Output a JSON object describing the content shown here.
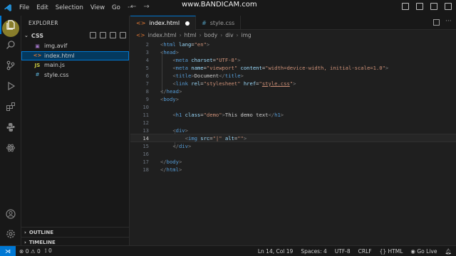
{
  "menu": [
    "File",
    "Edit",
    "Selection",
    "View",
    "Go",
    "···"
  ],
  "watermark": "www.BANDICAM.com",
  "explorer": {
    "title": "EXPLORER",
    "folder": "CSS",
    "files": [
      {
        "name": "img.avif",
        "icon": "image-icon"
      },
      {
        "name": "index.html",
        "icon": "html-icon"
      },
      {
        "name": "main.js",
        "icon": "js-icon"
      },
      {
        "name": "style.css",
        "icon": "css-icon"
      }
    ],
    "outline": "OUTLINE",
    "timeline": "TIMELINE"
  },
  "tabs": [
    {
      "label": "index.html",
      "modified": true
    },
    {
      "label": "style.css",
      "modified": false
    }
  ],
  "breadcrumb": [
    "index.html",
    "html",
    "body",
    "div",
    "img"
  ],
  "code": {
    "line_numbers": [
      "2",
      "3",
      "4",
      "5",
      "6",
      "7",
      "8",
      "9",
      "10",
      "11",
      "12",
      "13",
      "14",
      "15",
      "16",
      "17",
      "18"
    ],
    "current_line": "14"
  },
  "status": {
    "errors": "0",
    "warnings": "0",
    "ports": "0",
    "position": "Ln 14, Col 19",
    "spaces": "Spaces: 4",
    "encoding": "UTF-8",
    "eol": "CRLF",
    "language": "HTML",
    "golive": "Go Live"
  },
  "colors": {
    "accent": "#0078d4",
    "tag": "#569cd6",
    "attr": "#9cdcfe",
    "string": "#ce9178"
  }
}
